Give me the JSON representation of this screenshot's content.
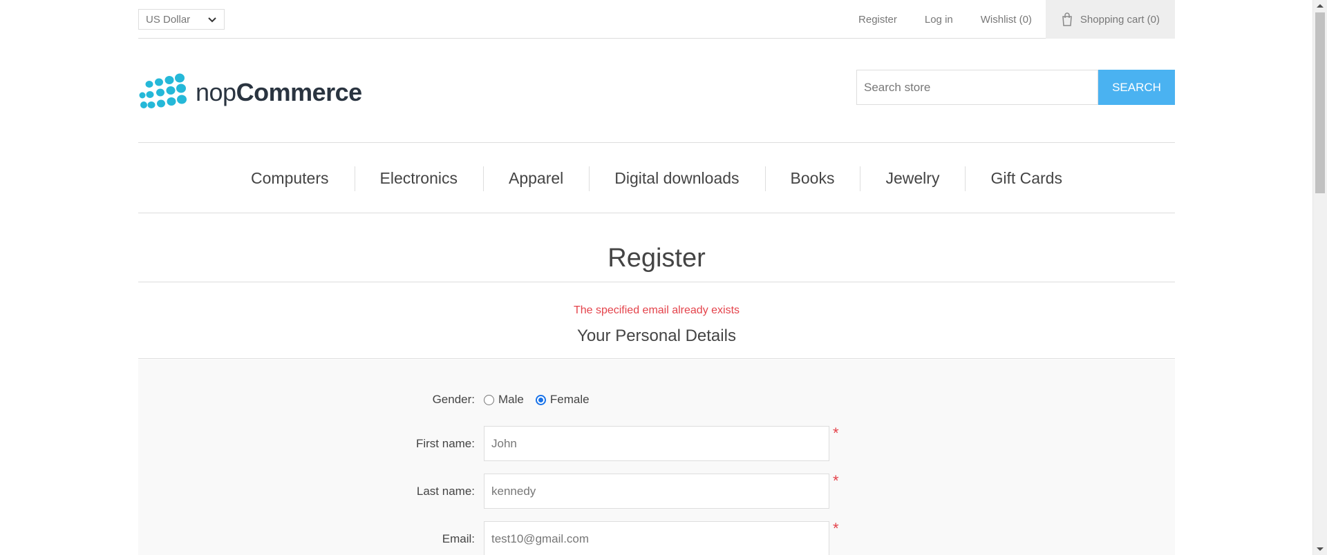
{
  "header": {
    "currency": "US Dollar",
    "links": {
      "register": "Register",
      "login": "Log in",
      "wishlist": "Wishlist (0)",
      "cart": "Shopping cart (0)"
    }
  },
  "logo": {
    "prefix": "nop",
    "name": "Commerce",
    "color": "#25b8d8"
  },
  "search": {
    "placeholder": "Search store",
    "button": "SEARCH",
    "button_color": "#4ab2f1"
  },
  "menu": [
    "Computers",
    "Electronics",
    "Apparel",
    "Digital downloads",
    "Books",
    "Jewelry",
    "Gift Cards"
  ],
  "page": {
    "title": "Register",
    "error": "The specified email already exists",
    "section_title": "Your Personal Details",
    "error_color": "#e4434b"
  },
  "form": {
    "gender": {
      "label": "Gender:",
      "male": "Male",
      "female": "Female",
      "selected": "Female"
    },
    "first_name": {
      "label": "First name:",
      "value": "John",
      "required": "*"
    },
    "last_name": {
      "label": "Last name:",
      "value": "kennedy",
      "required": "*"
    },
    "email": {
      "label": "Email:",
      "value": "test10@gmail.com",
      "required": "*"
    }
  }
}
